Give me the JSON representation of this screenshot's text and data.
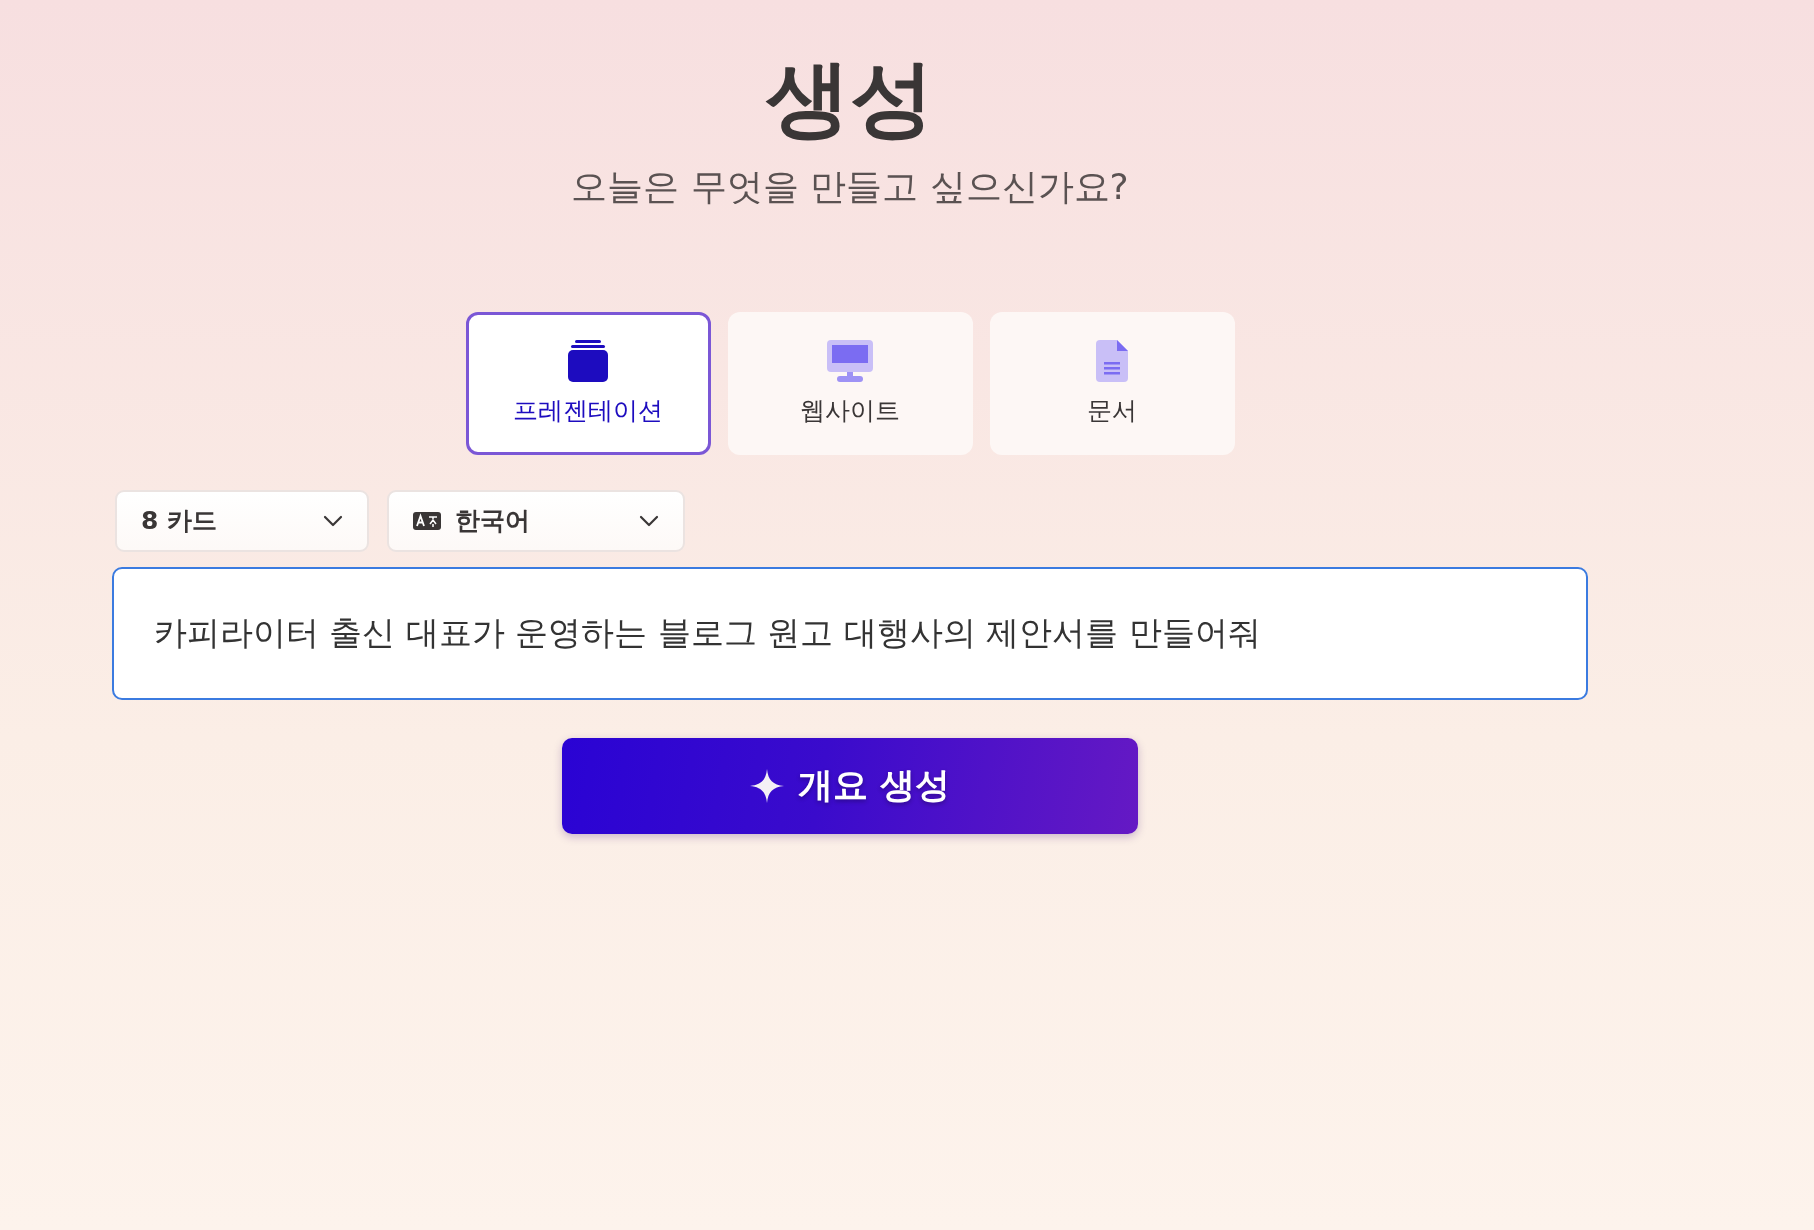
{
  "title": "생성",
  "subtitle": "오늘은 무엇을 만들고 싶으신가요?",
  "tabs": [
    {
      "label": "프레젠테이션",
      "kind": "presentation",
      "selected": true
    },
    {
      "label": "웹사이트",
      "kind": "website",
      "selected": false
    },
    {
      "label": "문서",
      "kind": "document",
      "selected": false
    }
  ],
  "dropdowns": [
    {
      "kind": "count",
      "value": "8 카드"
    },
    {
      "kind": "language",
      "value": "한국어"
    }
  ],
  "prompt": {
    "value": "카피라이터 출신 대표가 운영하는 블로그 원고 대행사의 제안서를 만들어줘"
  },
  "generate_button": {
    "label": "개요 생성"
  }
}
